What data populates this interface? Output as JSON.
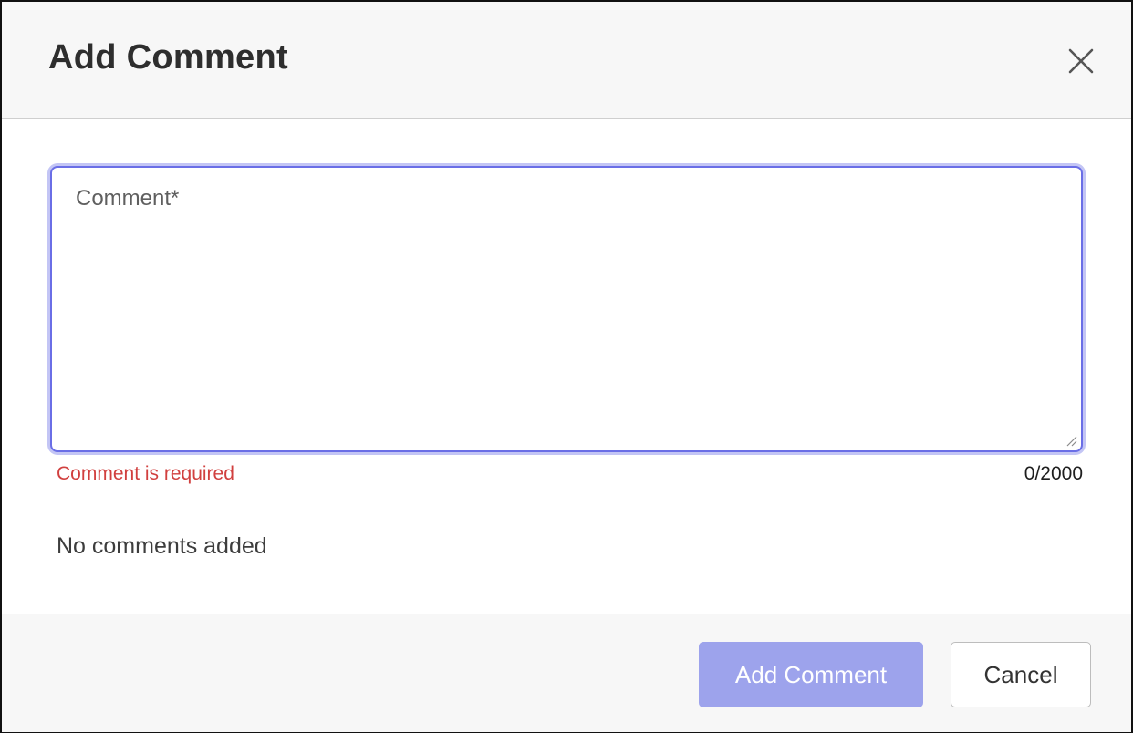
{
  "dialog": {
    "title": "Add Comment",
    "close_icon": "close-icon"
  },
  "comment": {
    "value": "",
    "placeholder": "Comment*",
    "error": "Comment is required",
    "counter": "0/2000"
  },
  "comments_list": {
    "empty_text": "No comments added"
  },
  "footer": {
    "add_label": "Add Comment",
    "cancel_label": "Cancel"
  },
  "colors": {
    "accent": "#6a6ee6",
    "primary_disabled": "#9da3ec",
    "error": "#d1403f"
  }
}
